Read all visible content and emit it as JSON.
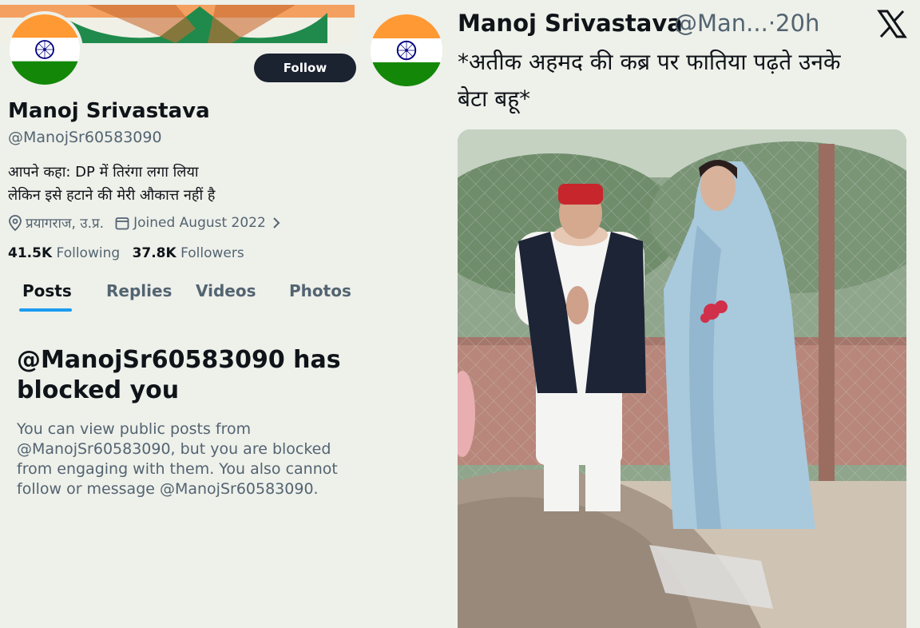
{
  "profile": {
    "name": "Manoj Srivastava",
    "handle": "@ManojSr60583090",
    "follow_label": "Follow",
    "bio_line1": "आपने कहा: DP में तिरंगा लगा लिया",
    "bio_line2": "लेकिन इसे हटाने की मेरी औकात्त नहीं है",
    "location": "प्रयागराज, उ.प्र.",
    "joined": "Joined August 2022",
    "following_count": "41.5K",
    "following_label": "Following",
    "followers_count": "37.8K",
    "followers_label": "Followers",
    "tabs": [
      {
        "label": "Posts",
        "active": true
      },
      {
        "label": "Replies",
        "active": false
      },
      {
        "label": "Videos",
        "active": false
      },
      {
        "label": "Photos",
        "active": false
      }
    ],
    "blocked_title_line1": "@ManojSr60583090 has",
    "blocked_title_line2": "blocked you",
    "blocked_desc": [
      "You can view public posts from",
      "@ManojSr60583090, but you are blocked",
      "from engaging with them. You also cannot",
      "follow or message @ManojSr60583090."
    ]
  },
  "tweet": {
    "author_name": "Manoj Srivastava",
    "author_handle": "@Man...",
    "time_sep": "·",
    "time": "20h",
    "text_line1": "*अतीक अहमद की कब्र पर फातिया पढ़ते उनके",
    "text_line2": "बेटा बहू*"
  },
  "icons": {
    "location": "map-pin-icon",
    "calendar": "calendar-icon",
    "chevron": "chevron-right-icon",
    "x_logo": "x-logo-icon"
  },
  "colors": {
    "background": "#eef0ea",
    "accent": "#1d9bf0",
    "follow_bg": "#1b2230",
    "muted": "#536471",
    "saffron": "#ff9933",
    "green": "#138808",
    "chakra": "#000080"
  }
}
